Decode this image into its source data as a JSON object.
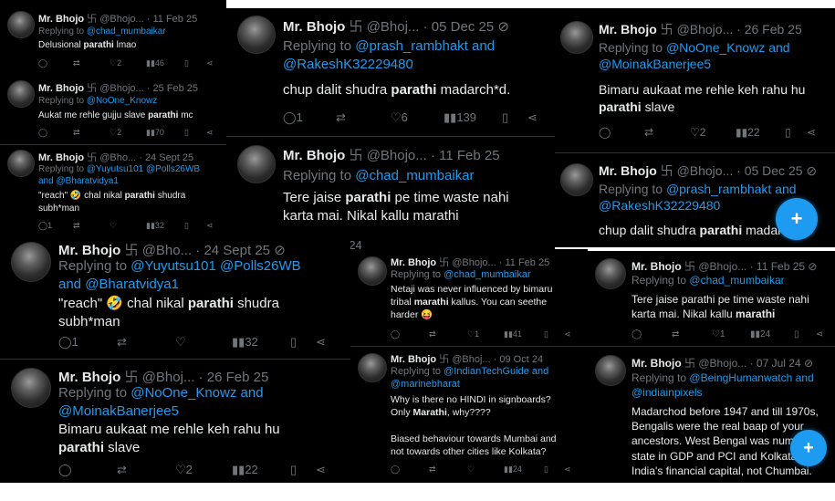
{
  "colors": {
    "background": "#000000",
    "text": "#e7e9ea",
    "muted": "#71767b",
    "accent": "#1d9bf0"
  },
  "author": {
    "name": "Mr. Bhojo",
    "symbol": "卐"
  },
  "p1": {
    "t1": {
      "handle": "@Bhojo...",
      "date": "· 11 Feb 25",
      "replying": "Replying to",
      "mention": "@chad_mumbaikar",
      "text_a": "Delusional ",
      "kw": "parathi",
      "text_b": " lmao",
      "likes": "2",
      "views": "46"
    },
    "t2": {
      "handle": "@Bhojo...",
      "date": "· 25 Feb 25",
      "replying": "Replying to",
      "mention": "@NoOne_Knowz",
      "text_a": "Aukat me rehle gujju slave ",
      "kw": "parathi",
      "text_b": " mc",
      "likes": "2",
      "views": "70"
    },
    "t3": {
      "handle": "@Bho...",
      "date": "· 24 Sept 25",
      "replying": "Replying to",
      "mention1": "@Yuyutsu101",
      "mention2": "@Polls26WB",
      "and": "and",
      "mention3": "@Bharatvidya1",
      "text_a": "\"reach\" 🤣 chal nikal ",
      "kw": "parathi",
      "text_b": " shudra",
      "text_c": "subh*man",
      "replies": "1",
      "views": "32"
    }
  },
  "p2": {
    "t1": {
      "handle": "@Bhoj...",
      "date": "· 05 Dec 25",
      "replying": "Replying to",
      "mention1": "@prash_rambhakt",
      "and": "and",
      "mention2": "@RakeshK32229480",
      "text_a": "chup dalit shudra ",
      "kw": "parathi",
      "text_b": " madarch*d.",
      "replies": "1",
      "likes": "6",
      "views": "139"
    },
    "t2": {
      "handle": "@Bhojo...",
      "date": "· 11 Feb 25",
      "replying": "Replying to",
      "mention": "@chad_mumbaikar",
      "text_a": "Tere jaise ",
      "kw": "parathi",
      "text_b": " pe time waste nahi",
      "text_c": "karta mai. Nikal kallu marathi",
      "replies": "1",
      "views": "24"
    }
  },
  "p3": {
    "t1": {
      "handle": "@Bhojo...",
      "date": "· 26 Feb 25",
      "replying": "Replying to",
      "mention1": "@NoOne_Knowz",
      "and": "and",
      "mention2": "@MoinakBanerjee5",
      "text_a": "Bimaru aukaat me rehle keh rahu hu",
      "kw": "parathi",
      "text_b": " slave",
      "likes": "2",
      "views": "22"
    },
    "t2": {
      "handle": "@Bhojo...",
      "date": "· 05 Dec 25",
      "replying": "Replying to",
      "mention1": "@prash_rambhakt",
      "and": "and",
      "mention2": "@RakeshK32229480",
      "text_a": "chup dalit shudra ",
      "kw": "parathi",
      "text_b": " madarc"
    }
  },
  "p4": {
    "t1": {
      "handle": "@Bho...",
      "date": "· 24 Sept 25",
      "replying": "Replying to",
      "mention1": "@Yuyutsu101",
      "mention2": "@Polls26WB",
      "and": "and",
      "mention3": "@Bharatvidya1",
      "text_a": "\"reach\" 🤣 chal nikal ",
      "kw": "parathi",
      "text_b": " shudra",
      "text_c": "subh*man",
      "replies": "1",
      "views": "32"
    },
    "t2": {
      "handle": "@Bhoj...",
      "date": "· 26 Feb 25",
      "replying": "Replying to",
      "mention1": "@NoOne_Knowz",
      "and": "and",
      "mention2": "@MoinakBanerjee5",
      "text_a": "Bimaru aukaat me rehle keh rahu hu",
      "kw": "parathi",
      "text_b": " slave",
      "likes": "2",
      "views": "22"
    }
  },
  "p5": {
    "t1": {
      "handle": "@Bhojo...",
      "date": "· 11 Feb 25",
      "replying": "Replying to",
      "mention": "@chad_mumbaikar",
      "line1": "Netaji was never influenced by bimaru",
      "text_a": "tribal ",
      "kw": "marathi",
      "text_b": " kallus. You can seethe",
      "line3": "harder 😝",
      "replies": "1",
      "views": "41"
    },
    "t2": {
      "handle": "@Bhoj...",
      "date": "· 09 Oct 24",
      "replying": "Replying to",
      "mention1": "@IndianTechGuide",
      "and": "and",
      "mention2": "@marinebharat",
      "line1": "Why is there no HINDI in signboards?",
      "text_a": "Only ",
      "kw": "Marathi",
      "text_b": ", why????",
      "line3": "Biased behaviour towards Mumbai and",
      "line4": "not towards other cities like Kolkata?",
      "views": "24"
    }
  },
  "p6": {
    "t1": {
      "handle": "@Bhojo...",
      "date": "· 11 Feb 25",
      "replying": "Replying to",
      "mention": "@chad_mumbaikar",
      "line1": "Tere jaise parathi pe time waste nahi",
      "text_a": "karta mai. Nikal kallu ",
      "kw": "marathi",
      "replies": "1",
      "views": "24"
    },
    "t2": {
      "handle": "@Bhojo...",
      "date": "· 07 Jul 24",
      "replying": "Replying to",
      "mention1": "@BeingHumanwatch",
      "and": "and",
      "mention2": "@indiainpixels",
      "line1": "Madarchod before 1947 and till 1970s,",
      "line2": "Bengalis were the real baap of your",
      "line3": "ancestors. West Bengal was num",
      "line4": "state in GDP and PCI and Kolkata",
      "line5": "India's financial capital, not Chumbai."
    }
  },
  "icons": [
    "reply-icon",
    "retweet-icon",
    "like-icon",
    "views-icon",
    "bookmark-icon",
    "share-icon",
    "grok-icon",
    "compose-icon"
  ],
  "fab": {
    "label": "+"
  }
}
